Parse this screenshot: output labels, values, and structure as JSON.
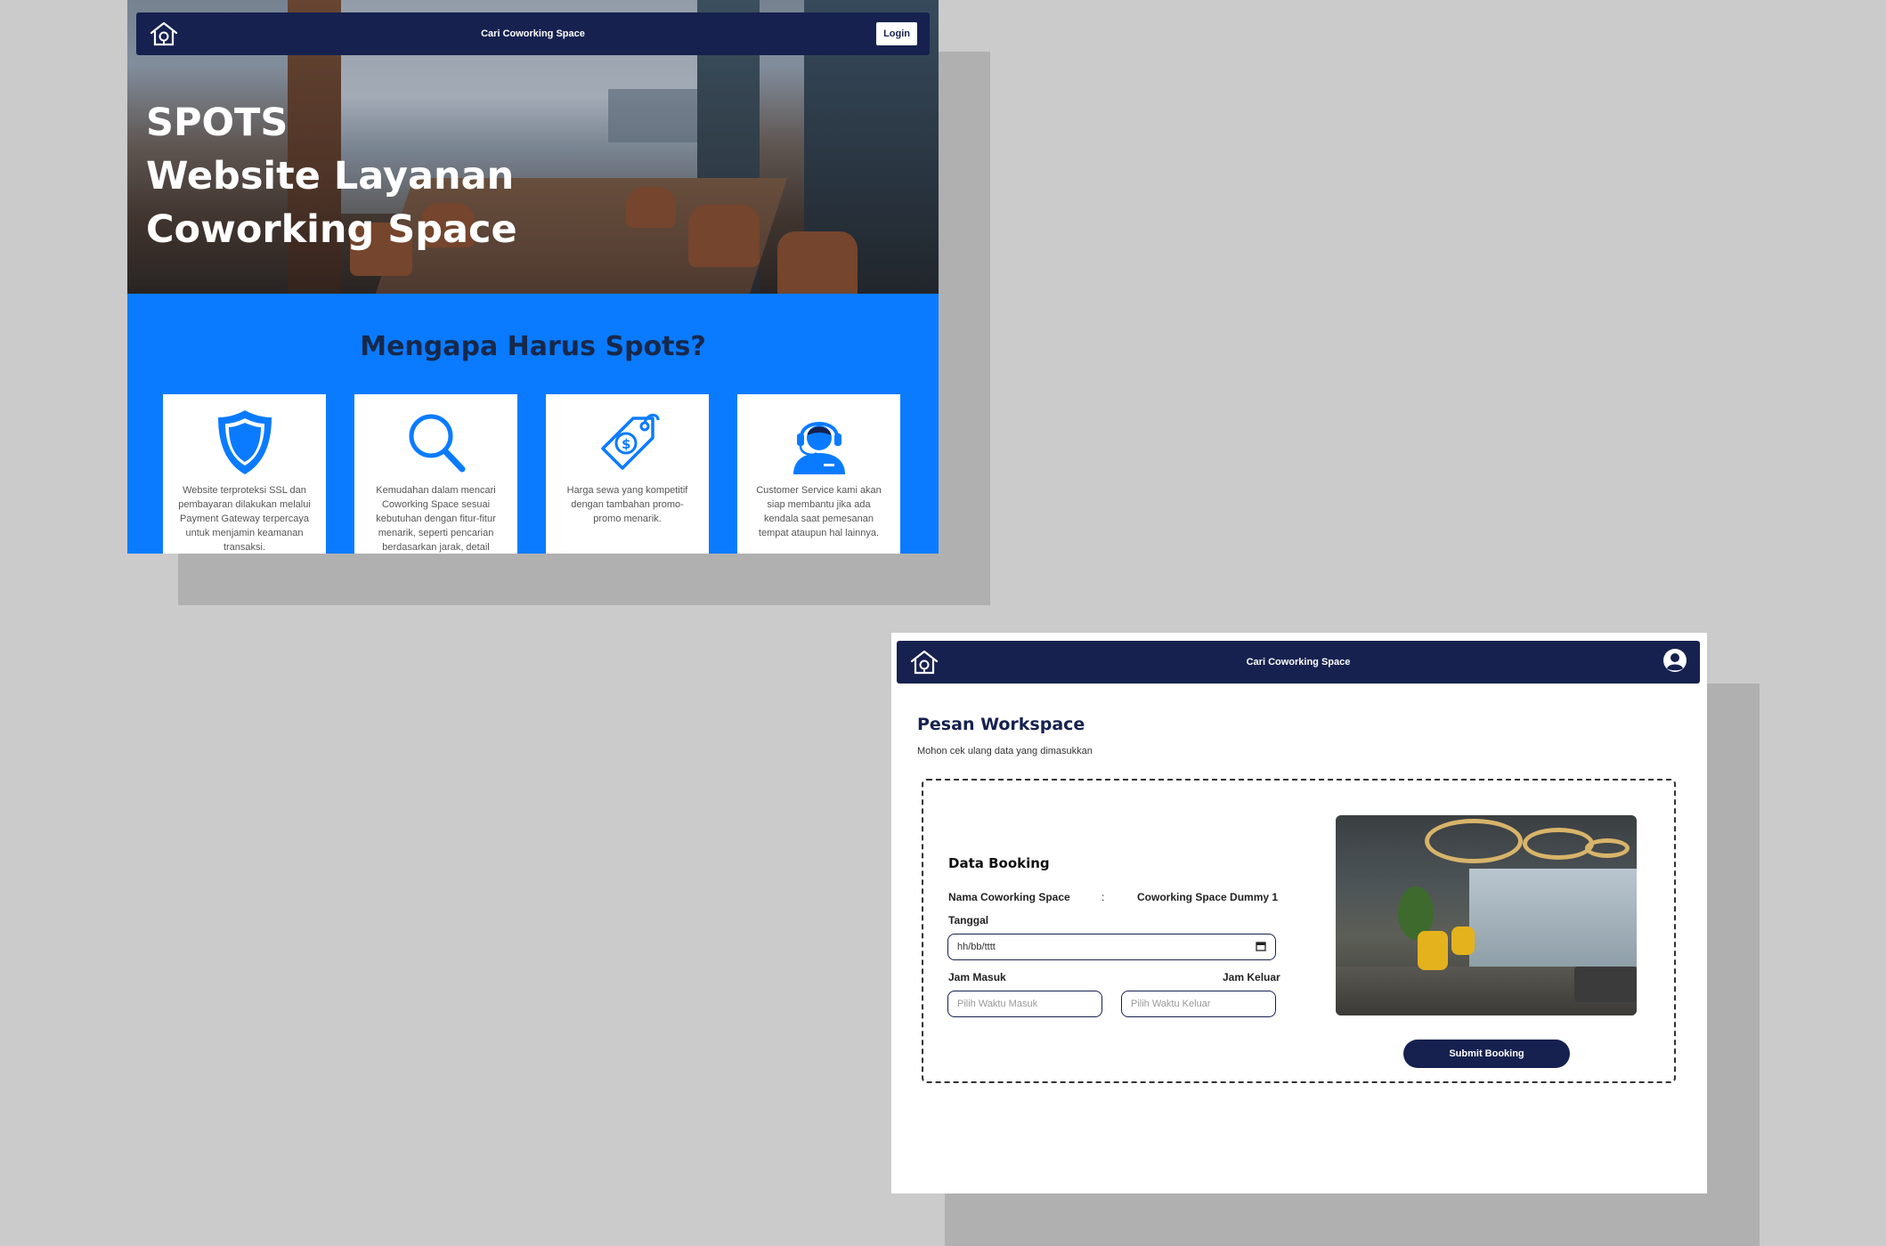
{
  "landing": {
    "nav": {
      "title": "Cari Coworking Space",
      "login_label": "Login",
      "logo_icon": "home-logo-icon"
    },
    "hero": {
      "line1": "SPOTS",
      "line2": "Website Layanan",
      "line3": "Coworking Space"
    },
    "why": {
      "title": "Mengapa Harus Spots?",
      "cards": [
        {
          "icon": "shield-icon",
          "text": "Website terproteksi SSL dan pembayaran dilakukan melalui Payment Gateway terpercaya untuk menjamin keamanan transaksi."
        },
        {
          "icon": "magnifier-icon",
          "text": "Kemudahan dalam mencari Coworking Space sesuai kebutuhan dengan fitur-fitur menarik, seperti pencarian berdasarkan jarak, detail"
        },
        {
          "icon": "price-tag-icon",
          "text": "Harga sewa yang kompetitif dengan tambahan promo-promo menarik."
        },
        {
          "icon": "customer-service-icon",
          "text": "Customer Service kami akan siap membantu jika ada kendala saat pemesanan tempat ataupun hal lainnya."
        }
      ]
    },
    "colors": {
      "nav_bg": "#16214f",
      "section_bg": "#0a7bff",
      "heading": "#17284a"
    }
  },
  "booking": {
    "nav": {
      "title": "Cari Coworking Space",
      "logo_icon": "home-logo-icon",
      "profile_icon": "user-avatar-icon"
    },
    "page_title": "Pesan Workspace",
    "page_subtitle": "Mohon cek ulang data yang dimasukkan",
    "form": {
      "section_title": "Data Booking",
      "name_label": "Nama Coworking Space",
      "name_colon": ":",
      "name_value": "Coworking Space Dummy 1",
      "date_label": "Tanggal",
      "date_value": "hh/bb/tttt",
      "time_in_label": "Jam Masuk",
      "time_out_label": "Jam Keluar",
      "time_in_placeholder": "Pilih Waktu Masuk",
      "time_out_placeholder": "Pilih Waktu Keluar",
      "submit_label": "Submit Booking"
    }
  }
}
